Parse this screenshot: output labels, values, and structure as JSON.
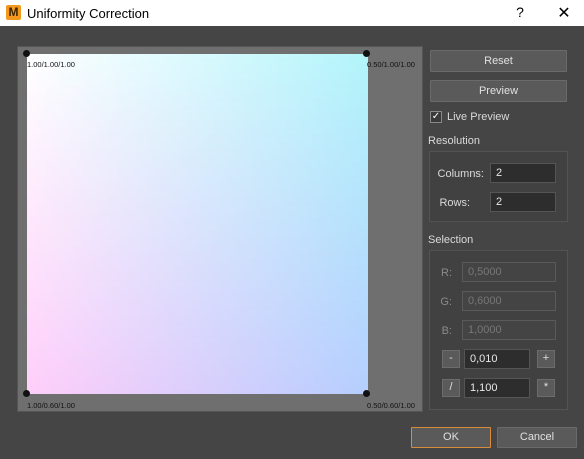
{
  "window": {
    "title": "Uniformity Correction",
    "icon_letter": "M",
    "help_glyph": "?",
    "close_glyph": "✕"
  },
  "canvas": {
    "labels": {
      "top_left": "1.00/1.00/1.00",
      "top_right": "0.50/1.00/1.00",
      "bottom_left": "1.00/0.60/1.00",
      "bottom_right": "0.50/0.60/1.00"
    }
  },
  "buttons": {
    "reset": "Reset",
    "preview": "Preview",
    "ok": "OK",
    "cancel": "Cancel"
  },
  "live_preview": {
    "label": "Live Preview",
    "checked": true,
    "check_glyph": "✓"
  },
  "resolution": {
    "title": "Resolution",
    "columns_label": "Columns:",
    "columns_value": "2",
    "rows_label": "Rows:",
    "rows_value": "2"
  },
  "selection": {
    "title": "Selection",
    "r_label": "R:",
    "r_value": "0,5000",
    "g_label": "G:",
    "g_value": "0,6000",
    "b_label": "B:",
    "b_value": "1,0000",
    "minus_label": "-",
    "add_value": "0,010",
    "plus_label": "+",
    "divide_label": "/",
    "mult_value": "1,100",
    "multiply_label": "*"
  },
  "colors": {
    "accent": "#f39a1e",
    "ok_border": "#d98c3a",
    "background": "#454545"
  }
}
